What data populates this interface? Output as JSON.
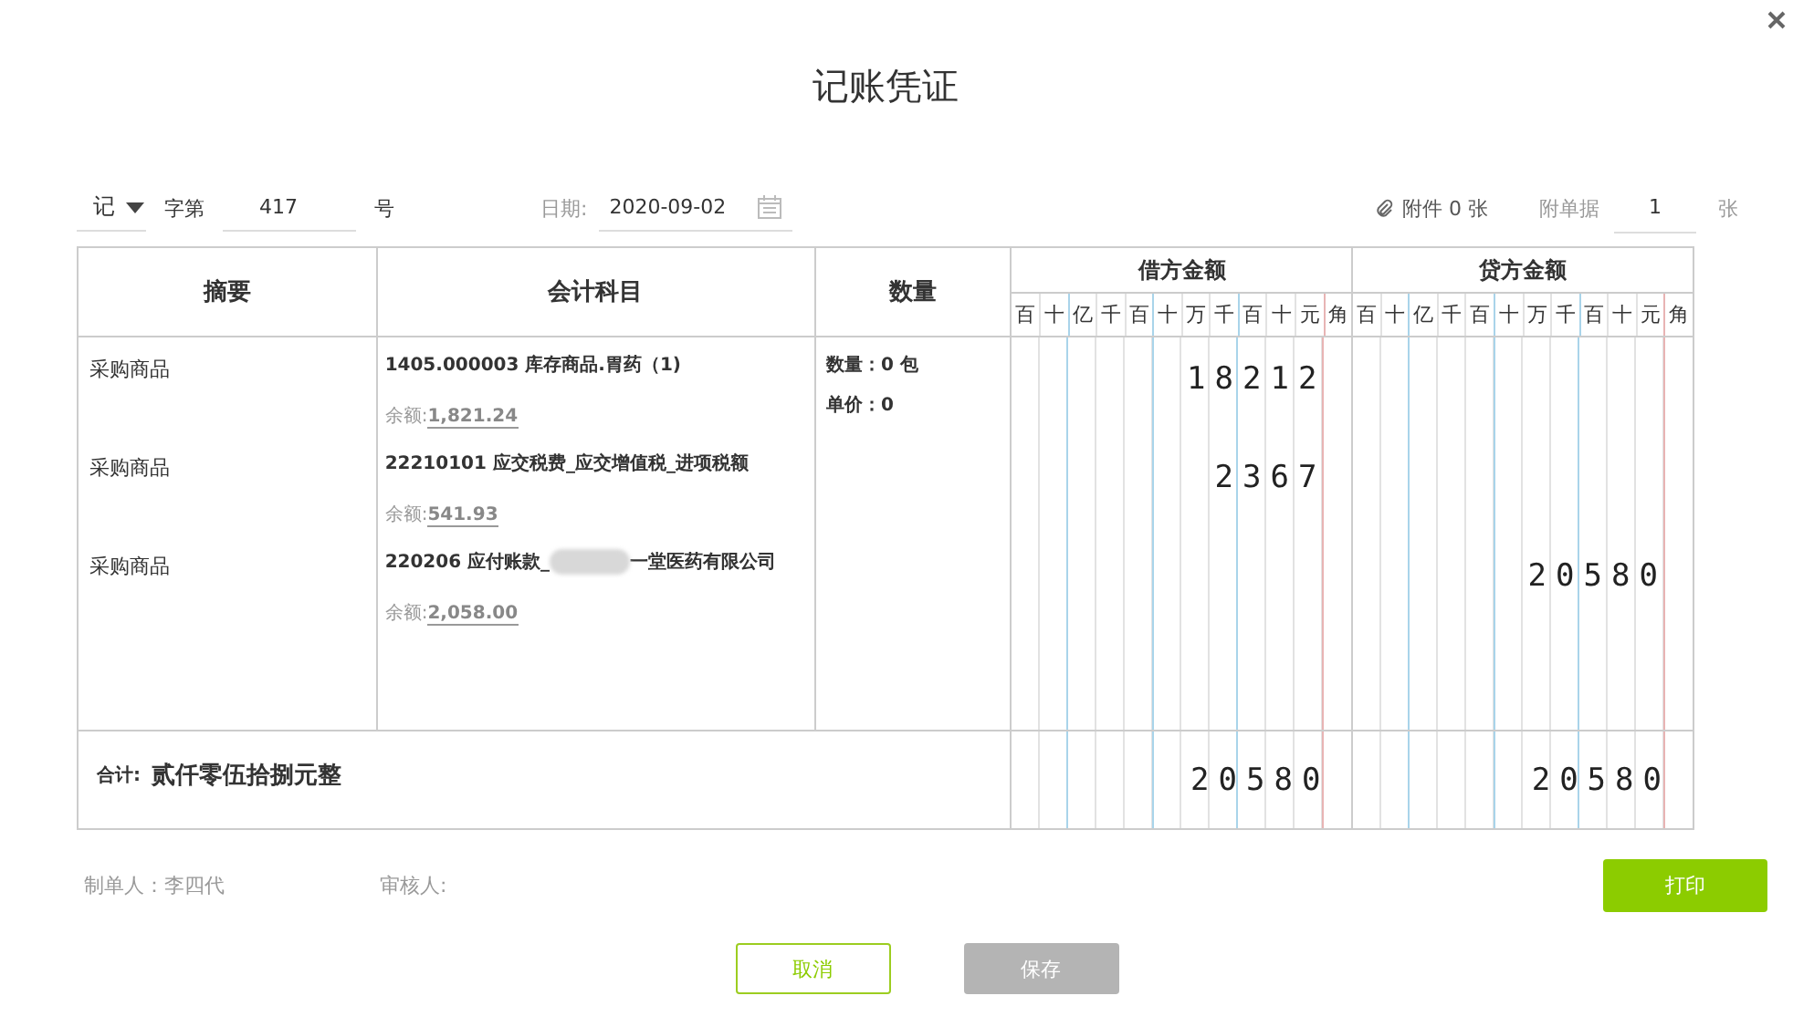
{
  "dialog": {
    "title": "记账凭证"
  },
  "voucher": {
    "type": "记",
    "word_label": "字第",
    "number": "417",
    "number_unit": "号",
    "date_label": "日期:",
    "date": "2020-09-02",
    "attachments": "附件 0 张",
    "attached_docs_label": "附单据",
    "attached_docs": "1",
    "attached_docs_unit": "张"
  },
  "table": {
    "columns": [
      "摘要",
      "会计科目",
      "数量",
      "借方金额",
      "贷方金额"
    ],
    "debit_digit_labels": [
      "百",
      "十",
      "亿",
      "千",
      "百",
      "十",
      "万",
      "千",
      "百",
      "十",
      "元",
      "角"
    ],
    "credit_digit_labels": [
      "百",
      "十",
      "亿",
      "千",
      "百",
      "十",
      "万",
      "千",
      "百",
      "十",
      "元",
      "角"
    ],
    "rows": [
      {
        "summary": "采购商品",
        "account": "1405.000003 库存商品.胃药（1)",
        "balance_label": "余额:",
        "balance": "1,821.24",
        "debit": "18212",
        "credit": ""
      },
      {
        "summary": "采购商品",
        "account": "22210101 应交税费_应交增值税_进项税额",
        "balance_label": "余额:",
        "balance": "541.93",
        "debit": "2367",
        "credit": ""
      },
      {
        "summary": "采购商品",
        "account": "220206 应付账款_",
        "account_after_redaction": "一堂医药有限公司",
        "balance_label": "余额:",
        "balance": "2,058.00",
        "debit": "",
        "credit": "20580"
      }
    ],
    "quantity": [
      "数量：0 包",
      "单价：0"
    ],
    "total": {
      "label": "合计:",
      "words": "贰仟零伍拾捌元整",
      "debit": "20580",
      "credit": "20580"
    }
  },
  "footer": {
    "preparer": "制单人：李四代",
    "reviewer": "审核人:"
  },
  "buttons": [
    {
      "kind": "print",
      "label": "打印",
      "disabled": false
    },
    {
      "kind": "cancel",
      "label": "取消",
      "disabled": false
    },
    {
      "kind": "save",
      "label": "保存",
      "disabled": true
    }
  ]
}
